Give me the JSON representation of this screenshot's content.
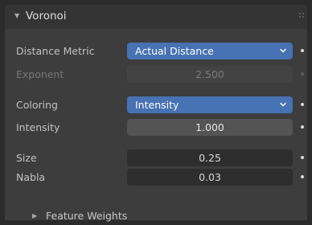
{
  "panel": {
    "title": "Voronoi",
    "expanded_icon": "triangle-down-icon",
    "rows": {
      "distance_metric": {
        "label": "Distance Metric",
        "value": "Actual Distance"
      },
      "exponent": {
        "label": "Exponent",
        "value": "2.500"
      },
      "coloring": {
        "label": "Coloring",
        "value": "Intensity"
      },
      "intensity": {
        "label": "Intensity",
        "value": "1.000"
      },
      "size": {
        "label": "Size",
        "value": "0.25"
      },
      "nabla": {
        "label": "Nabla",
        "value": "0.03"
      }
    },
    "subpanel": {
      "title": "Feature Weights",
      "collapsed_icon": "triangle-right-icon"
    }
  },
  "colors": {
    "accent": "#4772b3",
    "panel_bg": "#3d3d3d",
    "header_bg": "#343434"
  }
}
